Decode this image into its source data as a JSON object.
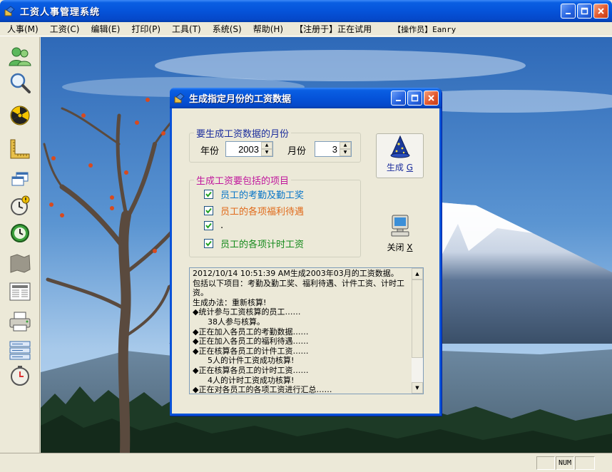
{
  "window": {
    "title": "工资人事管理系统"
  },
  "menu": {
    "items": [
      "人事(M)",
      "工资(C)",
      "编辑(E)",
      "打印(P)",
      "工具(T)",
      "系统(S)",
      "帮助(H)"
    ],
    "registered": "【注册于】正在试用",
    "operator": "【操作员】Eanry"
  },
  "toolbar": {
    "items": [
      "users-icon",
      "search-icon",
      "radiation-icon",
      "ruler-icon",
      "windows-icon",
      "alarm-clock-icon",
      "clock-icon",
      "map-icon",
      "newspaper-icon",
      "printer-icon",
      "list-icon",
      "timer-icon"
    ]
  },
  "dialog": {
    "title": "生成指定月份的工资数据",
    "month_group": {
      "legend": "要生成工资数据的月份",
      "year_label": "年份",
      "year_value": "2003",
      "month_label": "月份",
      "month_value": "3"
    },
    "items_group": {
      "legend": "生成工资要包括的项目",
      "items": [
        {
          "label": "员工的考勤及勤工奖",
          "checked": true,
          "color": "#0a76c8"
        },
        {
          "label": "员工的各项福利待遇",
          "checked": true,
          "color": "#e06a1a"
        },
        {
          "label": ".",
          "checked": true,
          "color": "#000000"
        },
        {
          "label": "员工的各项计时工资",
          "checked": true,
          "color": "#158a1c"
        }
      ]
    },
    "generate_button": {
      "label": "生成",
      "key": "G"
    },
    "close_button": {
      "label": "关闭",
      "key": "X"
    },
    "log_text": "2012/10/14 10:51:39 AM生成2003年03月的工资数据。\n包括以下项目：考勤及勤工奖、福利待遇、计件工资、计时工资。\n生成办法：重新核算!\n◆统计参与工资核算的员工……\n      38人参与核算。\n◆正在加入各员工的考勤数据……\n◆正在加入各员工的福利待遇……\n◆正在核算各员工的计件工资……\n      5人的计件工资成功核算!\n◆正在核算各员工的计时工资……\n      4人的计时工资成功核算!\n◆正在对各员工的各项工资进行汇总……"
  },
  "statusbar": {
    "num": "NUM"
  }
}
